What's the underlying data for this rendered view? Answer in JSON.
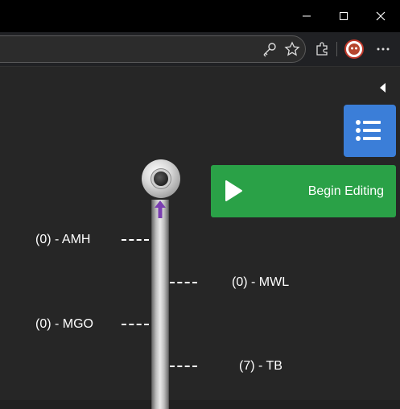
{
  "window": {
    "controls": [
      "minimize-icon",
      "maximize-icon",
      "close-icon"
    ]
  },
  "browser": {
    "toolbar_icons": [
      "key-icon",
      "favorite-star-icon",
      "extensions-icon",
      "profile-avatar-icon",
      "more-menu-icon"
    ]
  },
  "sidebar": {
    "collapse_icon": "chevron-left-icon",
    "list_button_icon": "list-icon"
  },
  "actions": {
    "begin_label": "Begin Editing",
    "begin_icon": "play-icon"
  },
  "timeline": {
    "markers": [
      {
        "label": "(0) - AMH",
        "side": "left"
      },
      {
        "label": "(0) - MWL",
        "side": "right"
      },
      {
        "label": "(0) - MGO",
        "side": "left"
      },
      {
        "label": "(7) - TB",
        "side": "right"
      }
    ]
  },
  "colors": {
    "accent_blue": "#3b7ed8",
    "accent_green": "#2aa147",
    "arrow_purple": "#7b3fb0",
    "background": "#262626"
  }
}
